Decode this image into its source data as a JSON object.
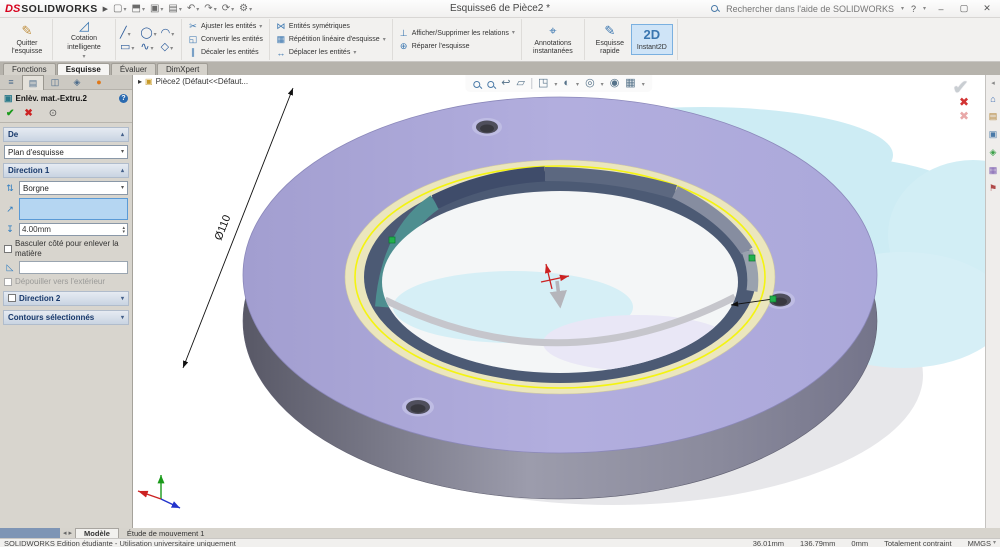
{
  "titlebar": {
    "logo_ds": "DS",
    "logo": "SOLIDWORKS",
    "title": "Esquisse6 de Pièce2 *",
    "search": "Rechercher dans l'aide de SOLIDWORKS",
    "help": "?",
    "minimize": "–",
    "maximize": "▢",
    "close": "✕"
  },
  "icons": {
    "play": "▶",
    "caret": "▾",
    "caret_up": "▴",
    "new": "▢",
    "open": "⬒",
    "save": "▣",
    "print": "▤",
    "undo": "↶",
    "redo": "↷",
    "rebuild": "⟳",
    "options": "⚙",
    "exit_sketch": "✎",
    "smart_dim": "◿",
    "line": "╱",
    "circle": "◯",
    "arc": "◠",
    "rect": "▭",
    "spline": "∿",
    "polygon": "◇",
    "trim": "✂",
    "convert": "◱",
    "offset": "∥",
    "mirror": "⋈",
    "pattern": "▦",
    "move": "↔",
    "relations": "⊥",
    "repair": "⊕",
    "instant_dims": "⌖",
    "rapid": "✎",
    "instant2d": "2D",
    "ok": "✔",
    "cancel": "✖",
    "eye": "⊙",
    "pm_feature": "≡",
    "pm_prop": "▤",
    "pm_config": "◫",
    "pm_dimx": "◈",
    "pm_display": "●",
    "pm_part": "▣",
    "reverse": "⇅",
    "dirref": "↗",
    "depth": "↧",
    "draft": "◺",
    "chev_right": "▸",
    "breadcrumb_part": "▣",
    "prev_view": "↩",
    "section": "▱",
    "orient": "◳",
    "style": "◐",
    "hideshow": "◎",
    "appearance": "◉",
    "scene": "▦",
    "home": "⌂",
    "library": "▤",
    "explorer": "▣",
    "palette": "◈",
    "scenes": "▦",
    "flag": "⚑",
    "tab_left": "◂",
    "tab_right": "▸",
    "confirm_check": "✔",
    "confirm_cancel": "✖"
  },
  "ribbon": {
    "buttons": [
      {
        "label": "Quitter l'esquisse"
      },
      {
        "label": "Cotation intelligente"
      },
      {
        "label": "Ajuster les entités"
      },
      {
        "label": "Convertir les entités"
      },
      {
        "label": "Décaler les entités"
      },
      {
        "label": "Entités symétriques"
      },
      {
        "label": "Répétition linéaire d'esquisse"
      },
      {
        "label": "Déplacer les entités"
      },
      {
        "label": "Afficher/Supprimer les relations"
      },
      {
        "label": "Réparer l'esquisse"
      },
      {
        "label": "Annotations instantanées"
      },
      {
        "label": "Esquisse rapide"
      },
      {
        "label": "Instant2D"
      }
    ]
  },
  "tabs": {
    "items": [
      "Fonctions",
      "Esquisse",
      "Évaluer",
      "DimXpert"
    ],
    "active": "Esquisse"
  },
  "property_manager": {
    "title": "Enlèv. mat.-Extru.2",
    "help": "?",
    "from_label": "De",
    "from_value": "Plan d'esquisse",
    "dir1_label": "Direction 1",
    "dir1_value": "Borgne",
    "depth_value": "4.00mm",
    "flip_label": "Basculer côté pour enlever la matière",
    "draft_label": "Dépouiller vers l'extérieur",
    "dir2_label": "Direction 2",
    "contours_label": "Contours sélectionnés"
  },
  "graphics": {
    "breadcrumb": "Pièce2 (Défaut<<Défaut...",
    "dimension": "Ø110"
  },
  "status": {
    "edition": "SOLIDWORKS Edition étudiante - Utilisation universitaire uniquement",
    "x": "36.01mm",
    "y": "136.79mm",
    "z": "0mm",
    "state": "Totalement contraint",
    "units": "MMGS"
  },
  "motion": {
    "tabs": [
      "Modèle",
      "Étude de mouvement 1"
    ]
  },
  "colors": {
    "model_top_face": "#aeabdc",
    "model_inner_ring": "#ebe6bd",
    "model_bore_wall": "#4c5a74",
    "sketch_highlight": "#f4f410",
    "selection_handle": "#22b14c",
    "reflection": "#cdecf4",
    "logo_red": "#d6001c",
    "instant2d_active": "#cfe4f7"
  }
}
